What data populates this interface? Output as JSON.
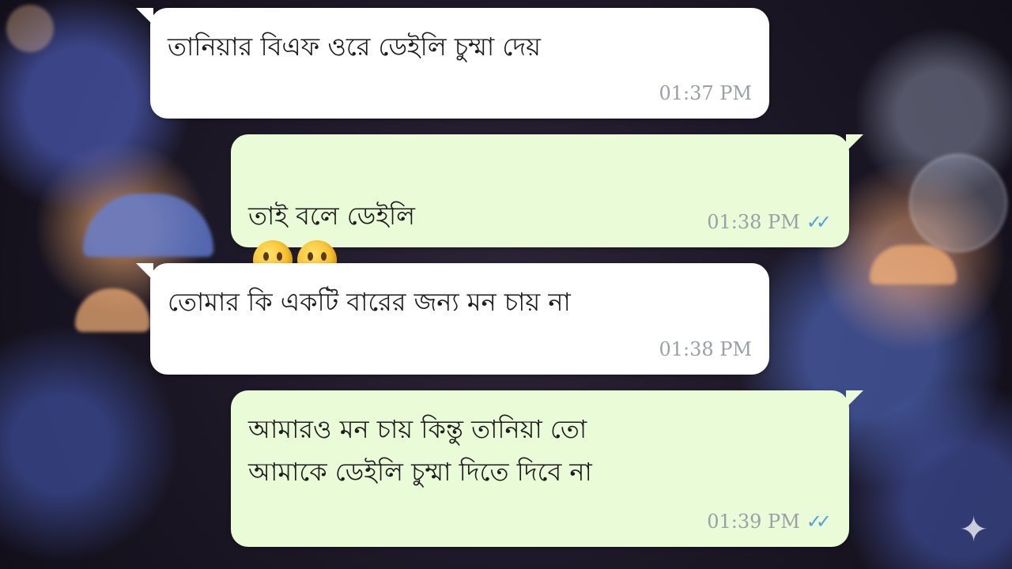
{
  "chat": {
    "messages": [
      {
        "direction": "incoming",
        "text": "তানিয়ার বিএফ ওরে ডেইলি চুম্মা দেয়",
        "time": "01:37 PM"
      },
      {
        "direction": "outgoing",
        "text": "তাই বলে ডেইলি",
        "time": "01:38 PM",
        "emoji": [
          "astonished-face-icon",
          "astonished-face-icon"
        ],
        "status": "read"
      },
      {
        "direction": "incoming",
        "text": "তোমার কি একটি বারের জন্য মন চায় না",
        "time": "01:38 PM"
      },
      {
        "direction": "outgoing",
        "text": "আমারও মন চায় কিন্তু তানিয়া তো\nআমাকে ডেইলি চুম্মা দিতে দিবে না",
        "time": "01:39 PM",
        "status": "read"
      }
    ],
    "colors": {
      "incoming_bubble": "#ffffff",
      "outgoing_bubble": "#eafbd8",
      "timestamp": "#9aa0a6",
      "read_ticks": "#4fa3e0"
    },
    "read_tick_glyph": "✓✓",
    "watermark_icon": "sparkle-icon"
  }
}
